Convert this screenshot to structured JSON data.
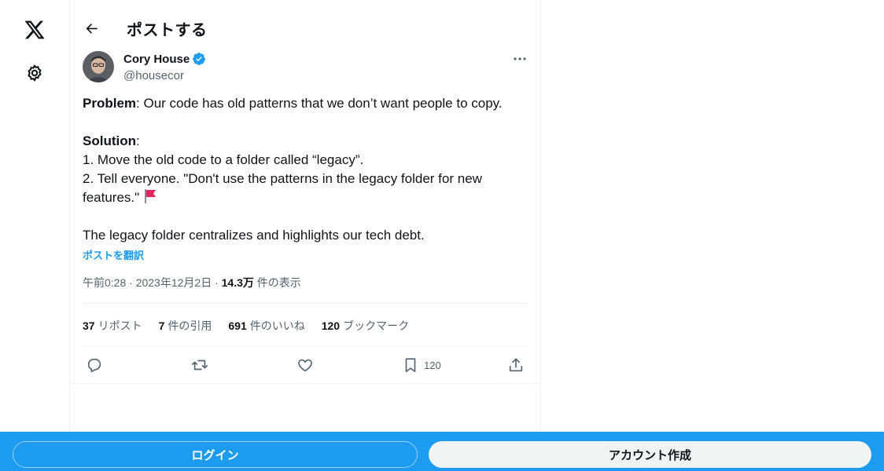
{
  "header": {
    "title": "ポストする"
  },
  "author": {
    "name": "Cory House",
    "handle": "@housecor"
  },
  "tweet": {
    "line1_bold": "Problem",
    "line1_rest": ": Our code has old patterns that we don’t want people to copy.",
    "solution_bold": "Solution",
    "solution_colon": ":",
    "step1": "1. Move the old code to a folder called “legacy”.",
    "step2": "2. Tell everyone. \"Don't use the patterns in the legacy folder for new features.\"",
    "closing": "The legacy folder centralizes and highlights our tech debt.",
    "translate_label": "ポストを翻訳"
  },
  "meta": {
    "time_date": "午前0:28 · 2023年12月2日 · ",
    "views_count": "14.3万",
    "views_label": " 件の表示"
  },
  "stats": {
    "reposts_count": "37",
    "reposts_label": "リポスト",
    "quotes_count": "7",
    "quotes_label": "件の引用",
    "likes_count": "691",
    "likes_label": "件のいいね",
    "bookmarks_count": "120",
    "bookmarks_label": "ブックマーク"
  },
  "actions": {
    "bookmark_count": "120"
  },
  "bottom": {
    "login_label": "ログイン",
    "signup_label": "アカウント作成"
  },
  "colors": {
    "accent": "#1d9bf0",
    "text": "#0f1419",
    "muted": "#536471",
    "border": "#eff3f4"
  }
}
